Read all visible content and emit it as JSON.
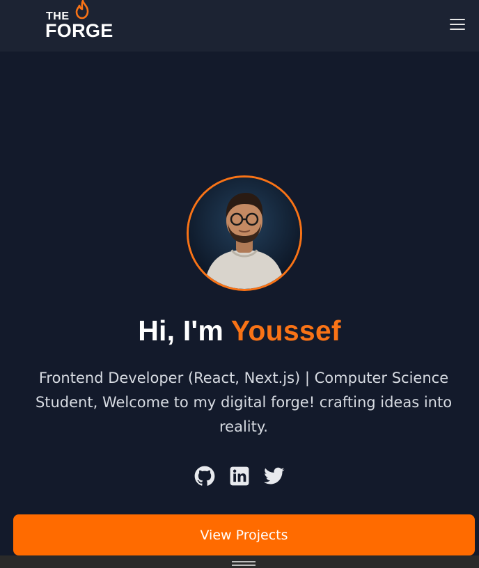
{
  "brand": {
    "line1": "THE",
    "line2": "FORGE",
    "flame_icon": "flame-icon",
    "accent_color": "#f97316"
  },
  "nav": {
    "menu_icon": "hamburger-menu-icon"
  },
  "hero": {
    "avatar_alt": "profile-photo",
    "greeting": "Hi, I'm ",
    "name": "Youssef",
    "bio": "Frontend Developer (React, Next.js) | Computer Science Student, Welcome to my digital forge! crafting ideas into reality."
  },
  "socials": [
    {
      "icon": "github-icon"
    },
    {
      "icon": "linkedin-icon"
    },
    {
      "icon": "twitter-icon"
    }
  ],
  "cta": {
    "label": "View Projects",
    "color": "#ff6b00"
  },
  "colors": {
    "background": "#131a2b",
    "header": "#1c2333"
  }
}
